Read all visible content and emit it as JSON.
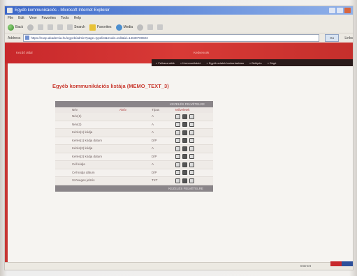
{
  "browser": {
    "title": "Egyéb kommunikációs - Microsoft Internet Explorer",
    "menu": [
      "File",
      "Edit",
      "View",
      "Favorites",
      "Tools",
      "Help"
    ],
    "toolbar": {
      "back": "Back",
      "search": "Search",
      "favorites": "Favorites",
      "media": "Media"
    },
    "address_label": "Address",
    "address_url": "https://eusp.akademia.hu/egyeb/admin?page=typelist&mode=edit&id=14630700823",
    "go_label": "Go",
    "links_label": "Links"
  },
  "site": {
    "header_left": "Kezdő oldal",
    "header_center": "Kedvencek",
    "nav": [
      "» Felhasználók",
      "» Kommunikáció",
      "» Egyéb adatok karbantartása",
      "» Belépés",
      "» Súgó"
    ]
  },
  "page": {
    "title": "Egyéb kommunikációs listája (MEMO_TEXT_3)"
  },
  "table": {
    "head_bar": "KEZELÉS FELVÉTELRE",
    "columns": [
      "Név",
      "Aktív",
      "Típus",
      "Műveletek"
    ],
    "rows": [
      {
        "name": "Név(1)",
        "type": "A"
      },
      {
        "name": "Név(2)",
        "type": "A"
      },
      {
        "name": "Kérés(1) kódja",
        "type": "A"
      },
      {
        "name": "Kérés(1) kódja dátum",
        "type": "D/P"
      },
      {
        "name": "Kérés(2) kódja",
        "type": "A"
      },
      {
        "name": "Kérés(2) kódja dátum",
        "type": "D/P"
      },
      {
        "name": "Cél kódja",
        "type": "A"
      },
      {
        "name": "Cél kódja dátum",
        "type": "D/P"
      },
      {
        "name": "Szöveges jelzés",
        "type": "TXT"
      }
    ],
    "foot_bar": "KEZELÉS FELVÉTELRE"
  },
  "status": {
    "zone": "Internet"
  },
  "colors": {
    "header_red": "#c8282b",
    "title_red": "#c93a30",
    "table_bar": "#8a8589"
  }
}
